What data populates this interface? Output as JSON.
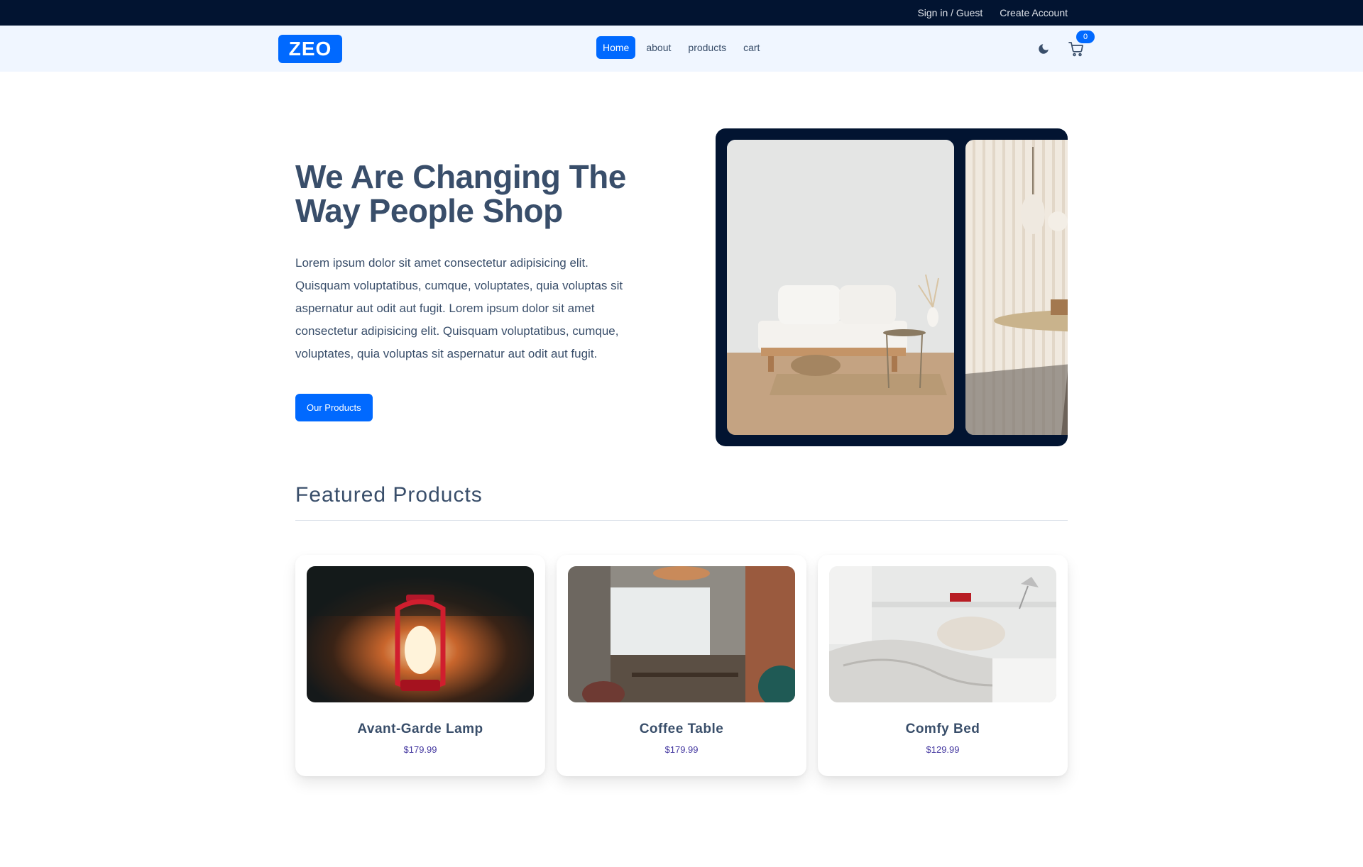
{
  "topbar": {
    "signin": "Sign in / Guest",
    "create": "Create Account"
  },
  "nav": {
    "logo": "ZEO",
    "links": [
      "Home",
      "about",
      "products",
      "cart"
    ],
    "cart_count": "0"
  },
  "hero": {
    "title": "We Are Changing The Way People Shop",
    "description": "Lorem ipsum dolor sit amet consectetur adipisicing elit. Quisquam voluptatibus, cumque, voluptates, quia voluptas sit aspernatur aut odit aut fugit. Lorem ipsum dolor sit amet consectetur adipisicing elit. Quisquam voluptatibus, cumque, voluptates, quia voluptas sit aspernatur aut odit aut fugit.",
    "button": "Our Products"
  },
  "featured": {
    "title": "Featured Products",
    "products": [
      {
        "title": "Avant-Garde Lamp",
        "price": "$179.99"
      },
      {
        "title": "Coffee Table",
        "price": "$179.99"
      },
      {
        "title": "Comfy Bed",
        "price": "$129.99"
      }
    ]
  },
  "colors": {
    "primary": "#0069ff",
    "dark": "#021431",
    "nav_bg": "#f0f6ff",
    "text": "#394e6a",
    "price": "#463aa1"
  },
  "icons": [
    "moon-icon",
    "cart-icon"
  ]
}
